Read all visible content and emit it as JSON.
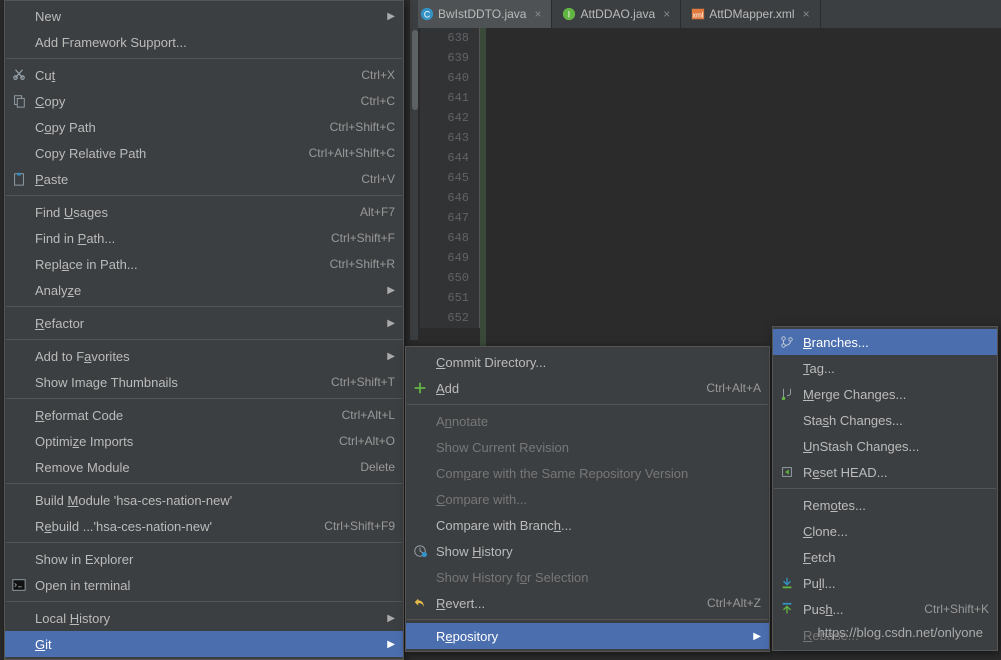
{
  "tabs": [
    {
      "label": "BwIstDDTO.java",
      "icon": "class-icon",
      "active": true,
      "bg": "#4e5254"
    },
    {
      "label": "AttDDAO.java",
      "icon": "interface-icon",
      "active": false,
      "bg": "#3c3f41"
    },
    {
      "label": "AttDMapper.xml",
      "icon": "xml-icon",
      "active": false,
      "bg": "#3c3f41"
    }
  ],
  "gutter": [
    "638",
    "639",
    "640",
    "641",
    "642",
    "643",
    "644",
    "645",
    "646",
    "647",
    "648",
    "649",
    "650",
    "651",
    "652"
  ],
  "menu1": {
    "items": [
      {
        "kind": "item",
        "label": "New",
        "arrow": true
      },
      {
        "kind": "item",
        "label": "Add Framework Support..."
      },
      {
        "kind": "sep"
      },
      {
        "kind": "item",
        "icon": "cut-icon",
        "label_html": "Cu<u class='mn'>t</u>",
        "shortcut": "Ctrl+X"
      },
      {
        "kind": "item",
        "icon": "copy-icon",
        "label_html": "<u class='mn'>C</u>opy",
        "shortcut": "Ctrl+C"
      },
      {
        "kind": "item",
        "label_html": "C<u class='mn'>o</u>py Path",
        "shortcut": "Ctrl+Shift+C"
      },
      {
        "kind": "item",
        "label": "Copy Relative Path",
        "shortcut": "Ctrl+Alt+Shift+C"
      },
      {
        "kind": "item",
        "icon": "paste-icon",
        "label_html": "<u class='mn'>P</u>aste",
        "shortcut": "Ctrl+V"
      },
      {
        "kind": "sep"
      },
      {
        "kind": "item",
        "label_html": "Find <u class='mn'>U</u>sages",
        "shortcut": "Alt+F7"
      },
      {
        "kind": "item",
        "label_html": "Find in <u class='mn'>P</u>ath...",
        "shortcut": "Ctrl+Shift+F"
      },
      {
        "kind": "item",
        "label_html": "Repl<u class='mn'>a</u>ce in Path...",
        "shortcut": "Ctrl+Shift+R"
      },
      {
        "kind": "item",
        "label_html": "Analy<u class='mn'>z</u>e",
        "arrow": true
      },
      {
        "kind": "sep"
      },
      {
        "kind": "item",
        "label_html": "<u class='mn'>R</u>efactor",
        "arrow": true
      },
      {
        "kind": "sep"
      },
      {
        "kind": "item",
        "label_html": "Add to F<u class='mn'>a</u>vorites",
        "arrow": true
      },
      {
        "kind": "item",
        "label": "Show Image Thumbnails",
        "shortcut": "Ctrl+Shift+T"
      },
      {
        "kind": "sep"
      },
      {
        "kind": "item",
        "label_html": "<u class='mn'>R</u>eformat Code",
        "shortcut": "Ctrl+Alt+L"
      },
      {
        "kind": "item",
        "label_html": "Optimi<u class='mn'>z</u>e Imports",
        "shortcut": "Ctrl+Alt+O"
      },
      {
        "kind": "item",
        "label": "Remove Module",
        "shortcut": "Delete"
      },
      {
        "kind": "sep"
      },
      {
        "kind": "item",
        "label_html": "Build <u class='mn'>M</u>odule 'hsa-ces-nation-new'"
      },
      {
        "kind": "item",
        "label_html": "R<u class='mn'>e</u>build ...'hsa-ces-nation-new'",
        "shortcut": "Ctrl+Shift+F9"
      },
      {
        "kind": "sep"
      },
      {
        "kind": "item",
        "label": "Show in Explorer"
      },
      {
        "kind": "item",
        "icon": "terminal-icon",
        "label": "Open in terminal"
      },
      {
        "kind": "sep"
      },
      {
        "kind": "item",
        "label_html": "Local <u class='mn'>H</u>istory",
        "arrow": true
      },
      {
        "kind": "item",
        "label_html": "<u class='mn'>G</u>it",
        "arrow": true,
        "highlight": true
      }
    ]
  },
  "menu2": {
    "items": [
      {
        "kind": "item",
        "label_html": "<u class='mn'>C</u>ommit Directory..."
      },
      {
        "kind": "item",
        "icon": "add-icon",
        "label_html": "<u class='mn'>A</u>dd",
        "shortcut": "Ctrl+Alt+A"
      },
      {
        "kind": "sep"
      },
      {
        "kind": "item",
        "disabled": true,
        "label_html": "A<u class='mn'>n</u>notate"
      },
      {
        "kind": "item",
        "disabled": true,
        "label": "Show Current Revision"
      },
      {
        "kind": "item",
        "disabled": true,
        "label_html": "Com<u class='mn'>p</u>are with the Same Repository Version"
      },
      {
        "kind": "item",
        "disabled": true,
        "label_html": "<u class='mn'>C</u>ompare with..."
      },
      {
        "kind": "item",
        "label_html": "Compare with Branc<u class='mn'>h</u>..."
      },
      {
        "kind": "item",
        "icon": "history-icon",
        "label_html": "Show <u class='mn'>H</u>istory"
      },
      {
        "kind": "item",
        "disabled": true,
        "label_html": "Show History f<u class='mn'>o</u>r Selection"
      },
      {
        "kind": "item",
        "icon": "revert-icon",
        "label_html": "<u class='mn'>R</u>evert...",
        "shortcut": "Ctrl+Alt+Z"
      },
      {
        "kind": "sep"
      },
      {
        "kind": "item",
        "label_html": "R<u class='mn'>e</u>pository",
        "arrow": true,
        "highlight": true
      }
    ]
  },
  "menu3": {
    "items": [
      {
        "kind": "item",
        "icon": "branch-icon",
        "label_html": "<u class='mn'>B</u>ranches...",
        "highlight": true
      },
      {
        "kind": "item",
        "label_html": "<u class='mn'>T</u>ag..."
      },
      {
        "kind": "item",
        "icon": "merge-icon",
        "label_html": "<u class='mn'>M</u>erge Changes..."
      },
      {
        "kind": "item",
        "label_html": "Sta<u class='mn'>s</u>h Changes..."
      },
      {
        "kind": "item",
        "label_html": "<u class='mn'>U</u>nStash Changes..."
      },
      {
        "kind": "item",
        "icon": "reset-icon",
        "label_html": "R<u class='mn'>e</u>set HEAD..."
      },
      {
        "kind": "sep"
      },
      {
        "kind": "item",
        "label_html": "Rem<u class='mn'>o</u>tes..."
      },
      {
        "kind": "item",
        "label_html": "<u class='mn'>C</u>lone..."
      },
      {
        "kind": "item",
        "label_html": "<u class='mn'>F</u>etch"
      },
      {
        "kind": "item",
        "icon": "pull-icon",
        "label_html": "Pu<u class='mn'>l</u>l..."
      },
      {
        "kind": "item",
        "icon": "push-icon",
        "label_html": "Pus<u class='mn'>h</u>...",
        "shortcut": "Ctrl+Shift+K"
      },
      {
        "kind": "item",
        "disabled": true,
        "label_html": "<u class='mn'>R</u>ebase..."
      }
    ]
  },
  "watermark": "https://blog.csdn.net/onlyone"
}
